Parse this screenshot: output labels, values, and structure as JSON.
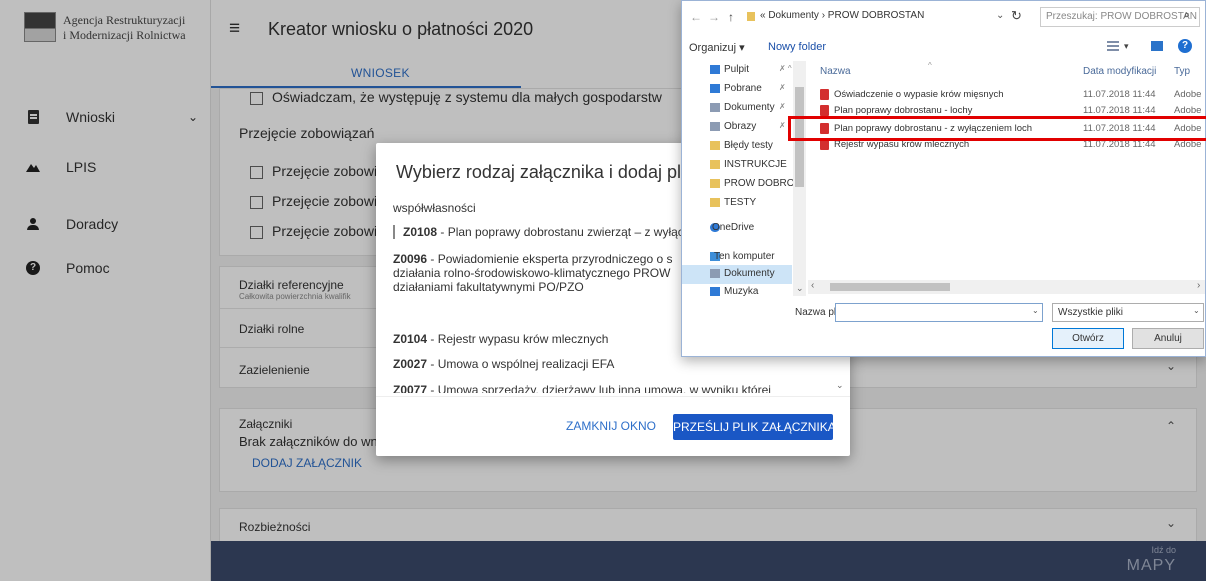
{
  "brand": {
    "org_line1": "Agencja Restrukturyzacji",
    "org_line2": "i Modernizacji Rolnictwa"
  },
  "sidebar": {
    "items": [
      {
        "label": "Wnioski",
        "icon": "document-icon",
        "has_chevron": true
      },
      {
        "label": "LPIS",
        "icon": "mountains-icon"
      },
      {
        "label": "Doradcy",
        "icon": "person-icon"
      },
      {
        "label": "Pomoc",
        "icon": "help-icon"
      }
    ],
    "chevron": "⌄"
  },
  "header": {
    "menu_icon": "≡",
    "title": "Kreator wniosku o płatności 2020"
  },
  "tabs": {
    "active": "WNIOSEK"
  },
  "form": {
    "small_farms_checkbox": "Oświadczam, że występuję z systemu dla małych gospodarstw",
    "takeover_section": "Przejęcie zobowiązań",
    "takeover_items": [
      "Przejęcie zobowiązań",
      "Przejęcie zobowiązań",
      "Przejęcie zobowiązań"
    ],
    "ref_plots_title": "Działki referencyjne",
    "ref_plots_sub": "Całkowita powierzchnia kwalifik",
    "agri_plots": "Działki rolne",
    "greening": "Zazielenienie",
    "attachments_title": "Załączniki",
    "attachments_none": "Brak załączników do wn",
    "add_attachment": "DODAJ ZAŁĄCZNIK",
    "discrepancies": "Rozbieżności",
    "chevron_down": "⌄",
    "chevron_up": "⌃"
  },
  "footer": {
    "goto": "Idź do",
    "map": "MAPY"
  },
  "modal": {
    "title": "Wybierz rodzaj załącznika i dodaj plik",
    "top_fragment": "współwłasności",
    "items": [
      {
        "code": "Z0108",
        "text": " - Plan poprawy dobrostanu zwierząt – z wyłąc"
      },
      {
        "code": "Z0096",
        "text": " - Powiadomienie eksperta przyrodniczego o s"
      },
      {
        "code": "",
        "text": "działania rolno-środowiskowo-klimatycznego PROW"
      },
      {
        "code": "",
        "text": "działaniami fakultatywnymi PO/PZO"
      },
      {
        "code": "Z0104",
        "text": " - Rejestr wypasu krów mlecznych"
      },
      {
        "code": "Z0027",
        "text": " - Umowa o wspólnej realizacji EFA"
      },
      {
        "code": "Z0077",
        "text": " - Umowa sprzedaży, dzierżawy lub inna umowa, w wyniku której"
      }
    ],
    "close_button": "ZAMKNIJ OKNO",
    "upload_button": "PRZEŚLIJ PLIK ZAŁĄCZNIKA",
    "scroll_down": "⌄"
  },
  "file_dialog": {
    "nav_back": "←",
    "nav_forward": "→",
    "nav_up": "↑",
    "path": "«  Dokumenty  ›  PROW DOBROSTAN",
    "path_dropdown": "⌄",
    "refresh": "↻",
    "search_placeholder": "Przeszukaj: PROW DOBROSTAN",
    "search_icon": "⌕",
    "organize": "Organizuj ▾",
    "new_folder": "Nowy folder",
    "view_dropdown": "▾",
    "help_icon": "?",
    "nav_items": [
      {
        "label": "Pulpit",
        "color": "#2f7ad6",
        "pin": "✗ ^"
      },
      {
        "label": "Pobrane",
        "color": "#2f7ad6",
        "pin": "✗"
      },
      {
        "label": "Dokumenty",
        "color": "#8c9bb3",
        "pin": "✗"
      },
      {
        "label": "Obrazy",
        "color": "#8c9bb3",
        "pin": "✗"
      },
      {
        "label": "Błędy testy",
        "color": "#e8c25c",
        "pin": ""
      },
      {
        "label": "INSTRUKCJE",
        "color": "#e8c25c",
        "pin": ""
      },
      {
        "label": "PROW DOBROST",
        "color": "#e8c25c",
        "pin": ""
      },
      {
        "label": "TESTY",
        "color": "#e8c25c",
        "pin": ""
      },
      {
        "label": "OneDrive",
        "color": "#2f7ad6",
        "pin": ""
      },
      {
        "label": "Ten komputer",
        "color": "#3d8ed8",
        "pin": ""
      },
      {
        "label": "Dokumenty",
        "color": "#8c9bb3",
        "pin": ""
      },
      {
        "label": "Muzyka",
        "color": "#2f7ad6",
        "pin": ""
      }
    ],
    "columns": {
      "name": "Nazwa",
      "date": "Data modyfikacji",
      "type": "Typ"
    },
    "sort_indicator": "^",
    "files": [
      {
        "name": "Oświadczenie o wypasie krów mięsnych",
        "date": "11.07.2018 11:44",
        "type": "Adobe"
      },
      {
        "name": "Plan poprawy dobrostanu - lochy",
        "date": "11.07.2018 11:44",
        "type": "Adobe"
      },
      {
        "name": "Plan poprawy dobrostanu - z wyłączeniem loch",
        "date": "11.07.2018 11:44",
        "type": "Adobe"
      },
      {
        "name": "Rejestr wypasu krów mlecznych",
        "date": "11.07.2018 11:44",
        "type": "Adobe"
      }
    ],
    "filename_label": "Nazwa pliku:",
    "filename_value": "",
    "name_dropdown": "⌄",
    "filter": "Wszystkie pliki",
    "filter_dropdown": "⌄",
    "open_button": "Otwórz",
    "cancel_button": "Anuluj",
    "hscroll_left": "‹",
    "hscroll_right": "›",
    "vscroll_down": "⌄"
  },
  "colors": {
    "accent": "#1a57c5",
    "highlight": "#e10000",
    "footer": "#3b4a6b"
  }
}
